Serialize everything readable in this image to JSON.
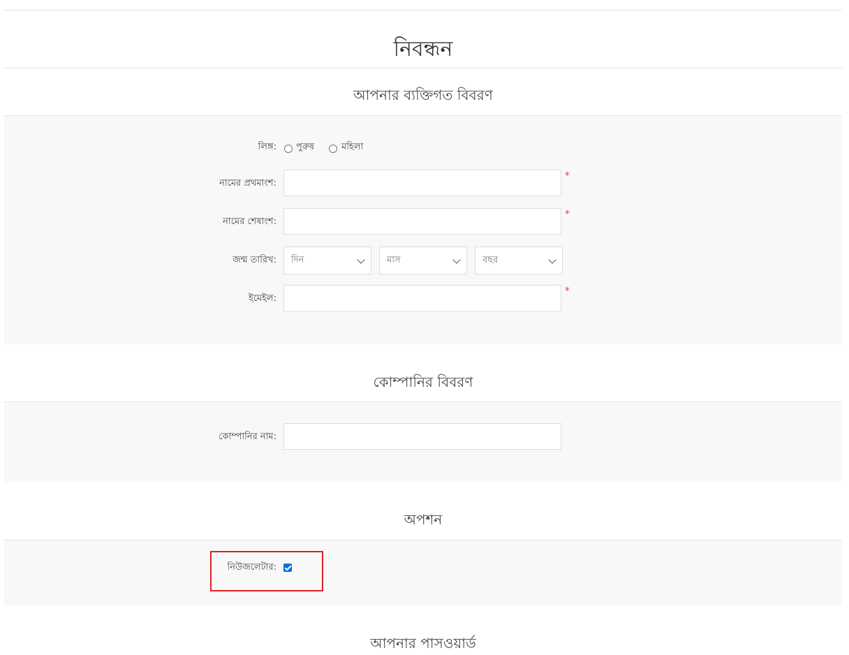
{
  "page": {
    "title": "নিবন্ধন"
  },
  "sections": {
    "personal": {
      "title": "আপনার ব্যক্তিগত বিবরণ",
      "gender_label": "লিঙ্গ:",
      "gender_options": [
        "পুরুষ",
        "মহিলা"
      ],
      "first_name_label": "নামের প্রথমাংশ:",
      "first_name_value": "",
      "last_name_label": "নামের শেষাংশ:",
      "last_name_value": "",
      "dob_label": "জন্ম তারিখ:",
      "dob_day": "দিন",
      "dob_month": "মাস",
      "dob_year": "বছর",
      "email_label": "ইমেইল:",
      "email_value": "",
      "required_marker": "*"
    },
    "company": {
      "title": "কোম্পানির বিবরণ",
      "company_name_label": "কোম্পানির নাম:",
      "company_name_value": ""
    },
    "options": {
      "title": "অপশন",
      "newsletter_label": "নিউজলেটার:",
      "newsletter_checked": true
    },
    "password": {
      "title": "আপনার পাসওয়ার্ড"
    }
  },
  "colors": {
    "panel_bg": "#f8f8f8",
    "required": "#e4434b",
    "checkbox": "#0b6ee0",
    "highlight": "#e02020"
  }
}
